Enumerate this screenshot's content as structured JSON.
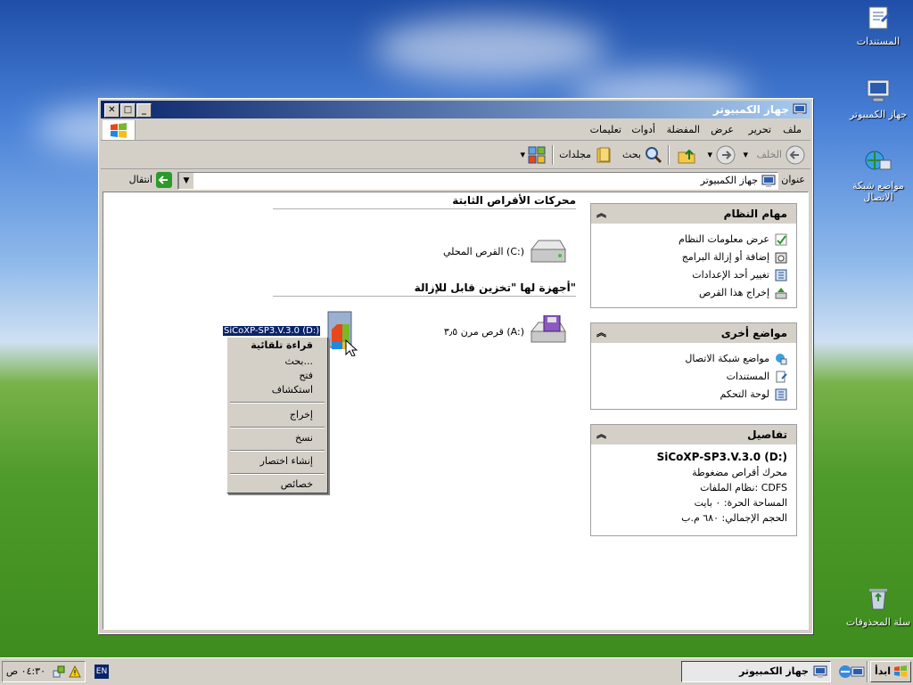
{
  "desktop": {
    "icons": [
      {
        "label": "المستندات",
        "icon": "documents-icon"
      },
      {
        "label": "جهاز الكمبيوتر",
        "icon": "computer-icon"
      },
      {
        "label_line1": "مواضع شبكة",
        "label_line2": "الاتصال",
        "icon": "network-icon"
      },
      {
        "label": "سلة المحذوفات",
        "icon": "recycle-bin-icon"
      }
    ]
  },
  "window": {
    "title": "جهاز الكمبيوتر",
    "menu": [
      "ملف",
      "تحرير",
      "عرض",
      "المفضلة",
      "أدوات",
      "تعليمات"
    ],
    "toolbar": {
      "back_label": "الخلف",
      "search_label": "بحث",
      "folders_label": "مجلدات"
    },
    "address": {
      "label": "عنوان",
      "value": "جهاز الكمبيوتر",
      "go_label": "انتقال"
    },
    "sections": {
      "fixed_title": "محركات الأقراص الثابتة",
      "removable_title": "أجهزة لها \"تخزين قابل للإزالة\""
    },
    "drives": {
      "local_disk": "القرص المحلي (C:)",
      "floppy": "قرص مرن ٣٫٥ (A:)",
      "cd_label": "SiCoXP-SP3.V.3.0 (D:)"
    },
    "panels": {
      "system_tasks": {
        "title": "مهام النظام",
        "items": [
          "عرض معلومات النظام",
          "إضافة أو إزالة البرامج",
          "تغيير أحد الإعدادات",
          "إخراج هذا القرص"
        ]
      },
      "other_places": {
        "title": "مواضع أخرى",
        "items": [
          "مواضع شبكة الاتصال",
          "المستندات",
          "لوحة التحكم"
        ]
      },
      "details": {
        "title": "تفاصيل",
        "name": "SiCoXP-SP3.V.3.0 (D:)",
        "type": "محرك أقراص مضغوطة",
        "filesystem": "نظام الملفات: CDFS",
        "free": "المساحة الحرة: ٠ بايت",
        "total": "الحجم الإجمالي: ٦٨٠ م.ب"
      }
    }
  },
  "context_menu": {
    "items": [
      "قراءة تلقائية",
      "بحث...",
      "فتح",
      "استكشاف",
      "إخراج",
      "نسخ",
      "إنشاء اختصار",
      "خصائص"
    ]
  },
  "taskbar": {
    "start_label": "ابدأ",
    "task_label": "جهاز الكمبيوتر",
    "lang": "EN",
    "clock": "٠٤:٣٠ ص"
  },
  "colors": {
    "title_active": "#0a246a",
    "face": "#d4d0c8",
    "selection": "#0a246a"
  }
}
